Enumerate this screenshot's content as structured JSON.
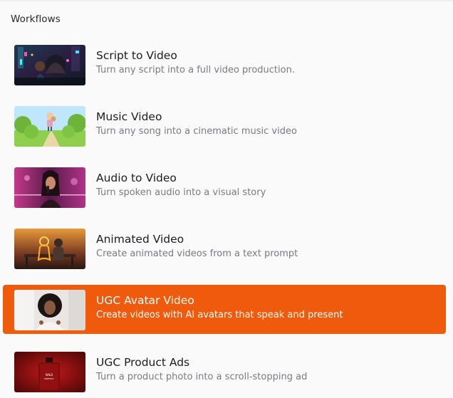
{
  "section": {
    "title": "Workflows"
  },
  "workflows": [
    {
      "title": "Script to Video",
      "description": "Turn any script into a full video production.",
      "thumbnail": "cyberpunk-scene-thumbnail",
      "active": false
    },
    {
      "title": "Music Video",
      "description": "Turn any song into a cinematic music video",
      "thumbnail": "cartoon-park-thumbnail",
      "active": false
    },
    {
      "title": "Audio to Video",
      "description": "Turn spoken audio into a visual story",
      "thumbnail": "singer-portrait-thumbnail",
      "active": false
    },
    {
      "title": "Animated Video",
      "description": "Create animated videos from a text prompt",
      "thumbnail": "glowing-couple-bench-thumbnail",
      "active": false
    },
    {
      "title": "UGC Avatar Video",
      "description": "Create videos with AI avatars that speak and present",
      "thumbnail": "avatar-presenter-thumbnail",
      "active": true
    },
    {
      "title": "UGC Product Ads",
      "description": "Turn a product photo into a scroll-stopping ad",
      "thumbnail": "perfume-bottle-thumbnail",
      "active": false
    }
  ],
  "product_label": {
    "line1": "WILD",
    "line2": "PERFECT"
  },
  "colors": {
    "active_bg": "#ef5a0c",
    "title": "#1c1c21",
    "description": "#7a7a82",
    "background": "#fafafa"
  }
}
